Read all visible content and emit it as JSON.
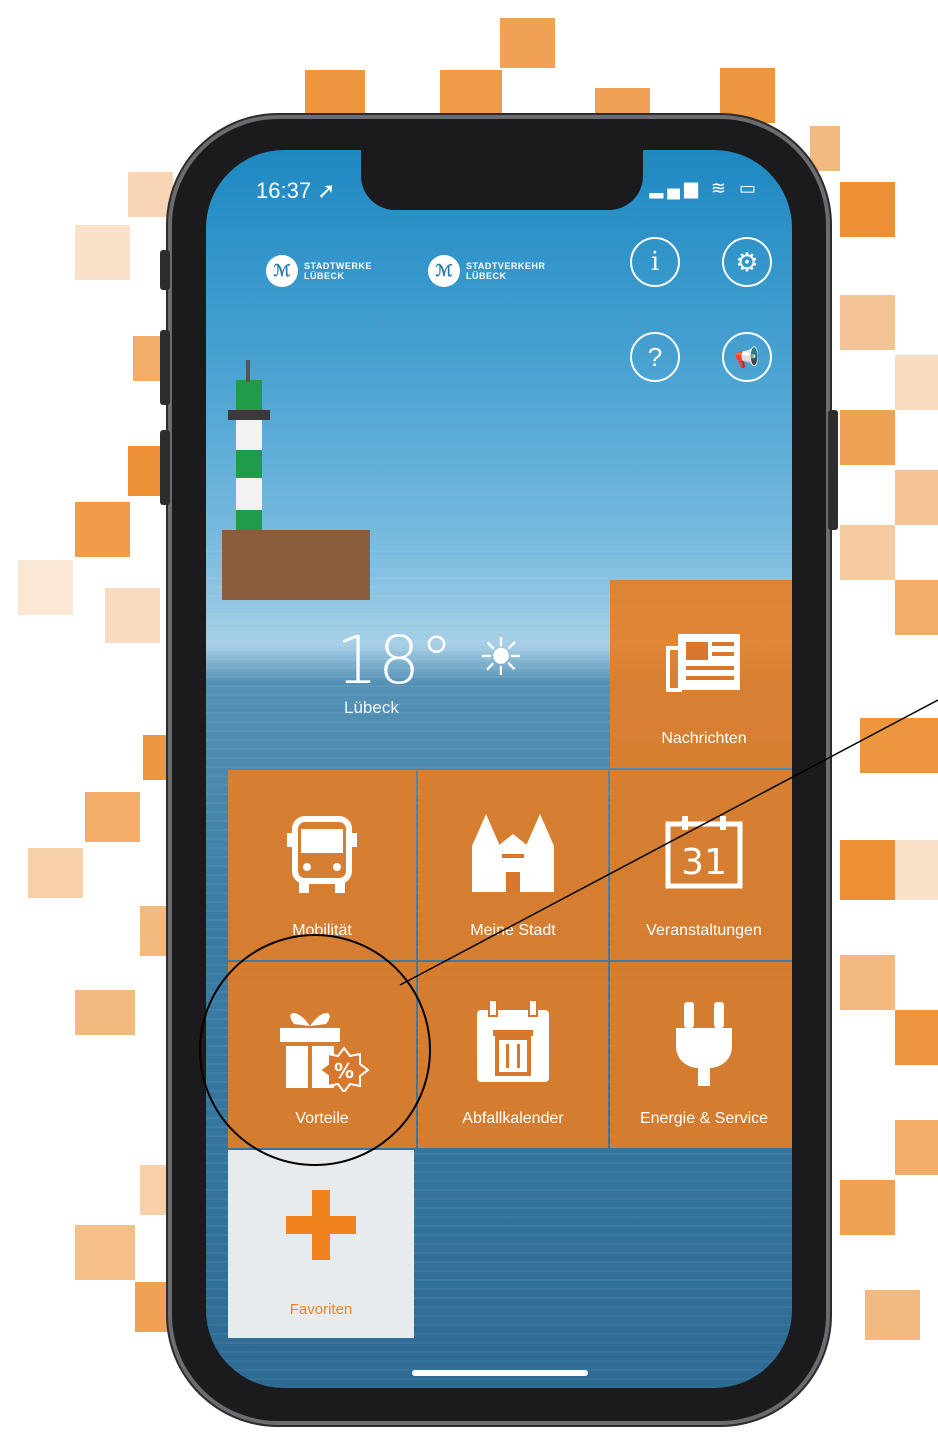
{
  "status_bar": {
    "time": "16:37 ➚",
    "icons": "▂▄▆ ≋ ▭"
  },
  "logos": [
    {
      "mark": "ℳ",
      "line1": "STADTWERKE",
      "line2": "LÜBECK"
    },
    {
      "mark": "ℳ",
      "line1": "STADTVERKEHR",
      "line2": "LÜBECK"
    }
  ],
  "top_buttons": {
    "info": "i",
    "settings": "⚙",
    "help": "?",
    "announce": "📢"
  },
  "weather": {
    "temp": "18°",
    "city": "Lübeck",
    "icon": "☀"
  },
  "tiles": {
    "nachrichten": "Nachrichten",
    "mobilitaet": "Mobilität",
    "meine_stadt": "Meine Stadt",
    "veranstaltungen": "Veranstaltungen",
    "calendar_day": "31",
    "vorteile": "Vorteile",
    "percent": "%",
    "abfallkalender": "Abfallkalender",
    "energie": "Energie & Service"
  },
  "favoriten": {
    "label": "Favoriten",
    "plus": "+"
  },
  "colors": {
    "accent": "#e57d23",
    "tile": "#d8782e",
    "fav_plus": "#f0821e"
  }
}
